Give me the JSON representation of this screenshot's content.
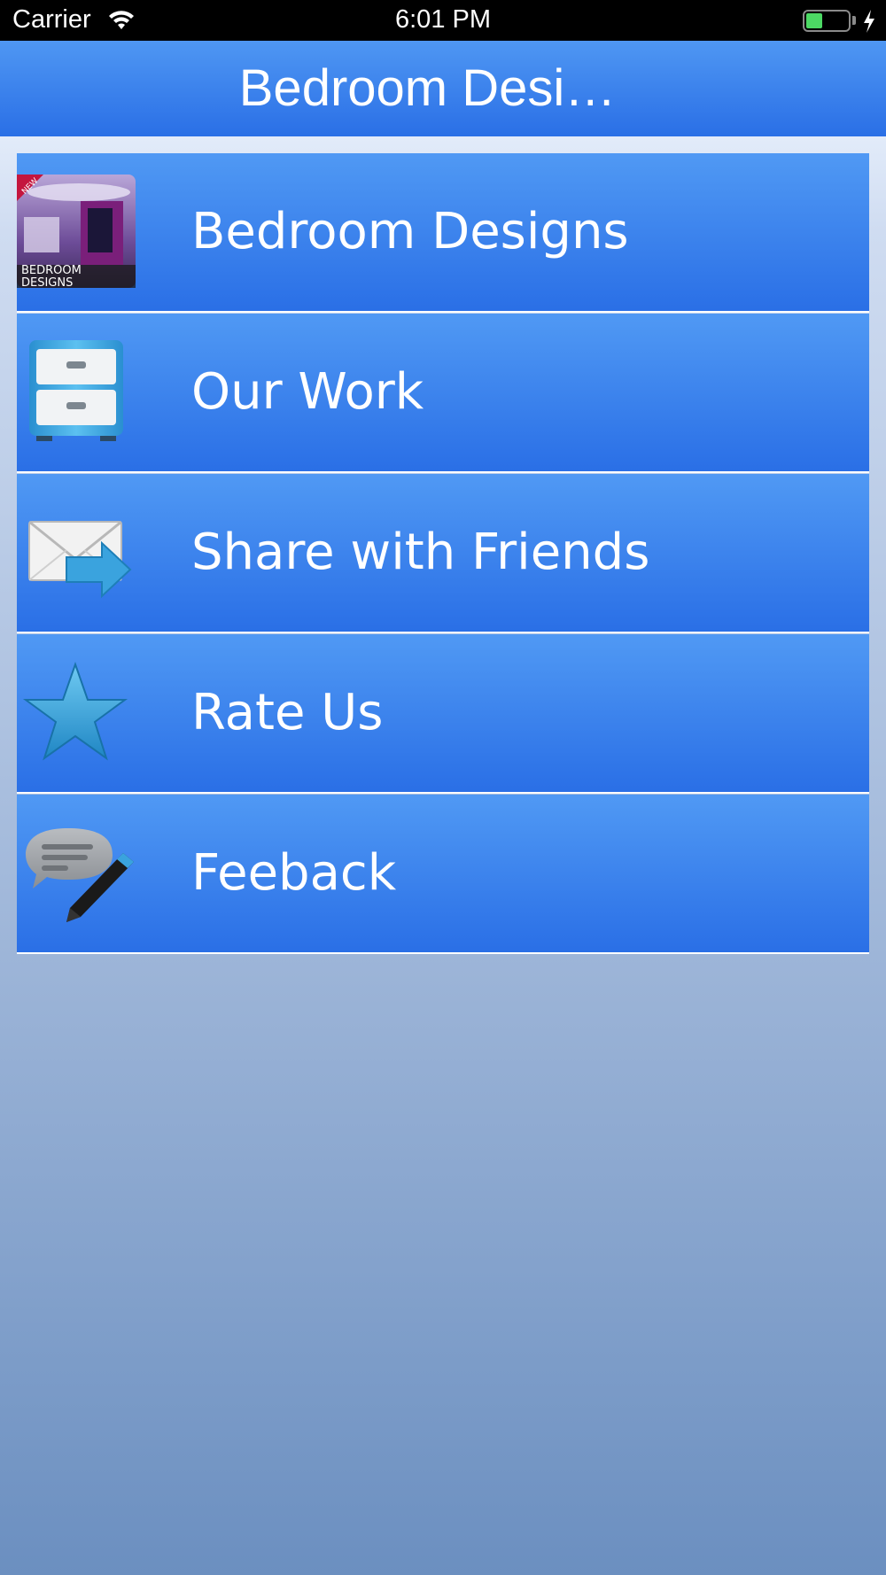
{
  "status_bar": {
    "carrier": "Carrier",
    "time": "6:01 PM",
    "battery_level": 0.4,
    "battery_color": "#4cd964"
  },
  "nav": {
    "title": "Bedroom Desi…"
  },
  "menu": {
    "items": [
      {
        "label": "Bedroom Designs",
        "icon": "app-thumbnail-icon",
        "thumb_badge": "NEW",
        "thumb_caption": "BEDROOM\nDESIGNS"
      },
      {
        "label": "Our Work",
        "icon": "file-cabinet-icon"
      },
      {
        "label": "Share with Friends",
        "icon": "envelope-share-icon"
      },
      {
        "label": "Rate Us",
        "icon": "star-icon"
      },
      {
        "label": "Feeback",
        "icon": "speech-bubble-pencil-icon"
      }
    ]
  },
  "colors": {
    "nav_gradient_top": "#4f97f3",
    "nav_gradient_bottom": "#2a6fe6",
    "row_gradient_top": "#5099f4",
    "row_gradient_bottom": "#2a6fe6"
  }
}
